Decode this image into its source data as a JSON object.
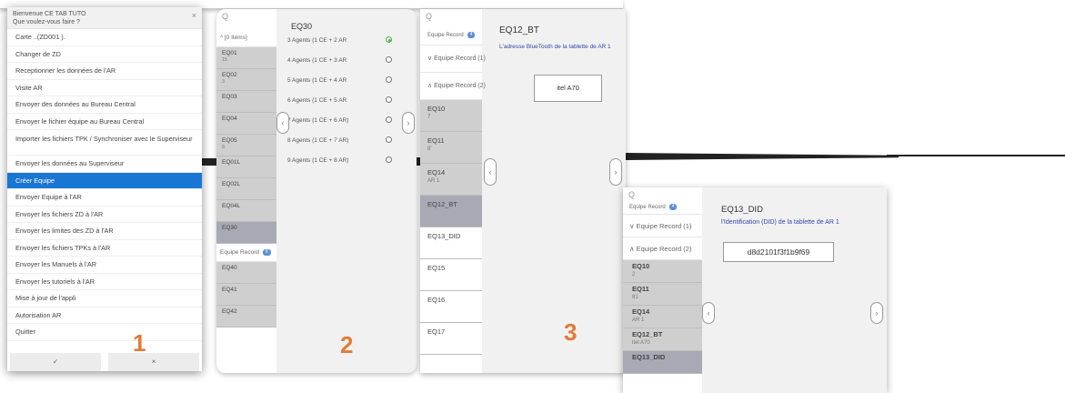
{
  "panel1": {
    "title": "Bienvenue CE TAB TUTO",
    "subtitle": "Que voulez-vous faire ?",
    "close_glyph": "×",
    "items": [
      "Carte ..(ZD001 ).",
      "Changer de ZD",
      "Receptionner les données de l'AR",
      "Visite AR",
      "Envoyer des données au Bureau Central",
      "Envoyer le fichier équipe au Bureau Central",
      "Importer les fichiers TPK / Synchroniser avec le Superviseur",
      "Envoyer les données au Superviseur",
      "Créer Equipe",
      "Envoyer Equipe à l'AR",
      "Envoyer les fichiers ZD à l'AR",
      "Envoyer les limites des ZD à l'AR",
      "Envoyer les fichiers TPKs à l'AR",
      "Envoyer les Manuels à l'AR",
      "Envoyer les tutoriels à l'AR",
      "Mise à jour de l'appli",
      "Autorisation AR",
      "Quitter"
    ],
    "selected_item": "Créer Equipe",
    "ok_glyph": "✓",
    "cancel_glyph": "×",
    "step_number": "1"
  },
  "panel2": {
    "search_glyph": "Q",
    "group_label": "^ [0 Items]",
    "rows": [
      {
        "code": "EQ01",
        "sub": "15"
      },
      {
        "code": "EQ02",
        "sub": "3"
      },
      {
        "code": "EQ03",
        "sub": ""
      },
      {
        "code": "EQ04",
        "sub": ""
      },
      {
        "code": "EQ05",
        "sub": "8"
      },
      {
        "code": "EQ01L",
        "sub": ""
      },
      {
        "code": "EQ02L",
        "sub": ""
      },
      {
        "code": "EQ04L",
        "sub": ""
      },
      {
        "code": "EQ30",
        "sub": ""
      }
    ],
    "group2_label": "Equipe Record",
    "group2_badge": "6",
    "rows2": [
      {
        "code": "EQ40",
        "sub": ""
      },
      {
        "code": "EQ41",
        "sub": ""
      },
      {
        "code": "EQ42",
        "sub": ""
      }
    ],
    "code": "EQ30",
    "options": [
      "3 Agents (1 CE + 2 AR",
      "4 Agents (1 CE + 3 AR",
      "5 Agents (1 CE + 4 AR",
      "6 Agents (1 CE + 5 AR",
      "7 Agents (1 CE + 6 AR)",
      "8 Agents (1 CE + 7 AR)",
      "9 Agents (1 CE + 8 AR)"
    ],
    "left_arrow": "‹",
    "right_arrow": "›",
    "step_number": "2"
  },
  "panel3": {
    "search_glyph": "Q",
    "top_group": "Equipe Record",
    "top_badge": "4",
    "group1": "Equipe Record (1)",
    "group2": "Equipe Record (2)",
    "rows": [
      {
        "code": "EQ10",
        "sub": "7"
      },
      {
        "code": "EQ11",
        "sub": "8'"
      },
      {
        "code": "EQ14",
        "sub": "AR 1"
      },
      {
        "code": "EQ12_BT",
        "sub": ""
      },
      {
        "code": "EQ13_DID",
        "sub": ""
      },
      {
        "code": "EQ15",
        "sub": ""
      },
      {
        "code": "EQ16",
        "sub": ""
      },
      {
        "code": "EQ17",
        "sub": ""
      }
    ],
    "code": "EQ12_BT",
    "description": "L'adresse BlueTooth de la tablette de AR 1",
    "input_value": "itel A70",
    "left_arrow": "‹",
    "right_arrow": "›",
    "step_number": "3"
  },
  "panel4": {
    "search_glyph": "Q",
    "top_group": "Equipe Record",
    "top_badge": "4",
    "group1": "Equipe Record (1)",
    "group2": "Equipe Record (2)",
    "rows": [
      {
        "code": "EQ10",
        "sub": "2"
      },
      {
        "code": "EQ11",
        "sub": "81"
      },
      {
        "code": "EQ14",
        "sub": "AR 1"
      },
      {
        "code": "EQ12_BT",
        "sub": "itel A70"
      },
      {
        "code": "EQ13_DID",
        "sub": ""
      }
    ],
    "code": "EQ13_DID",
    "description": "l'Identification (DID) de la tablette de AR 1",
    "input_value": "d8d2101f3f1b9f69",
    "left_arrow": "‹",
    "right_arrow": "›"
  }
}
